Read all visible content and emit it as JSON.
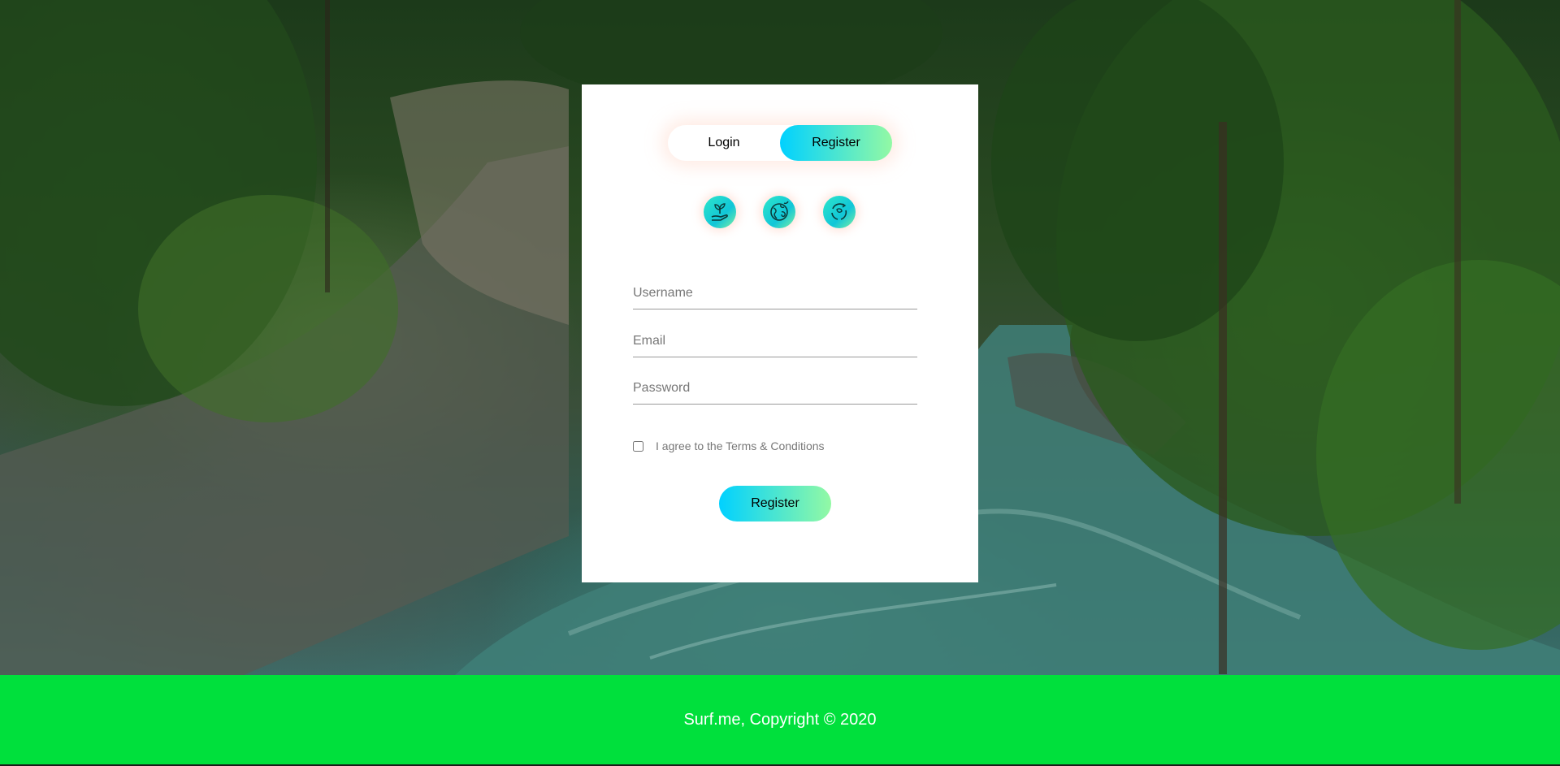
{
  "auth": {
    "tabs": {
      "login_label": "Login",
      "register_label": "Register",
      "active": "register"
    },
    "social_icons": [
      "plant-hand-icon",
      "earth-icon",
      "recycle-earth-icon"
    ],
    "fields": {
      "username_placeholder": "Username",
      "email_placeholder": "Email",
      "password_placeholder": "Password"
    },
    "terms_label": "I agree to the Terms & Conditions",
    "terms_checked": false,
    "submit_label": "Register"
  },
  "footer": {
    "text": "Surf.me, Copyright © 2020"
  },
  "colors": {
    "gradient_start": "#00d1ff",
    "gradient_end": "#93f9a4",
    "footer_bg": "#00e03c"
  }
}
